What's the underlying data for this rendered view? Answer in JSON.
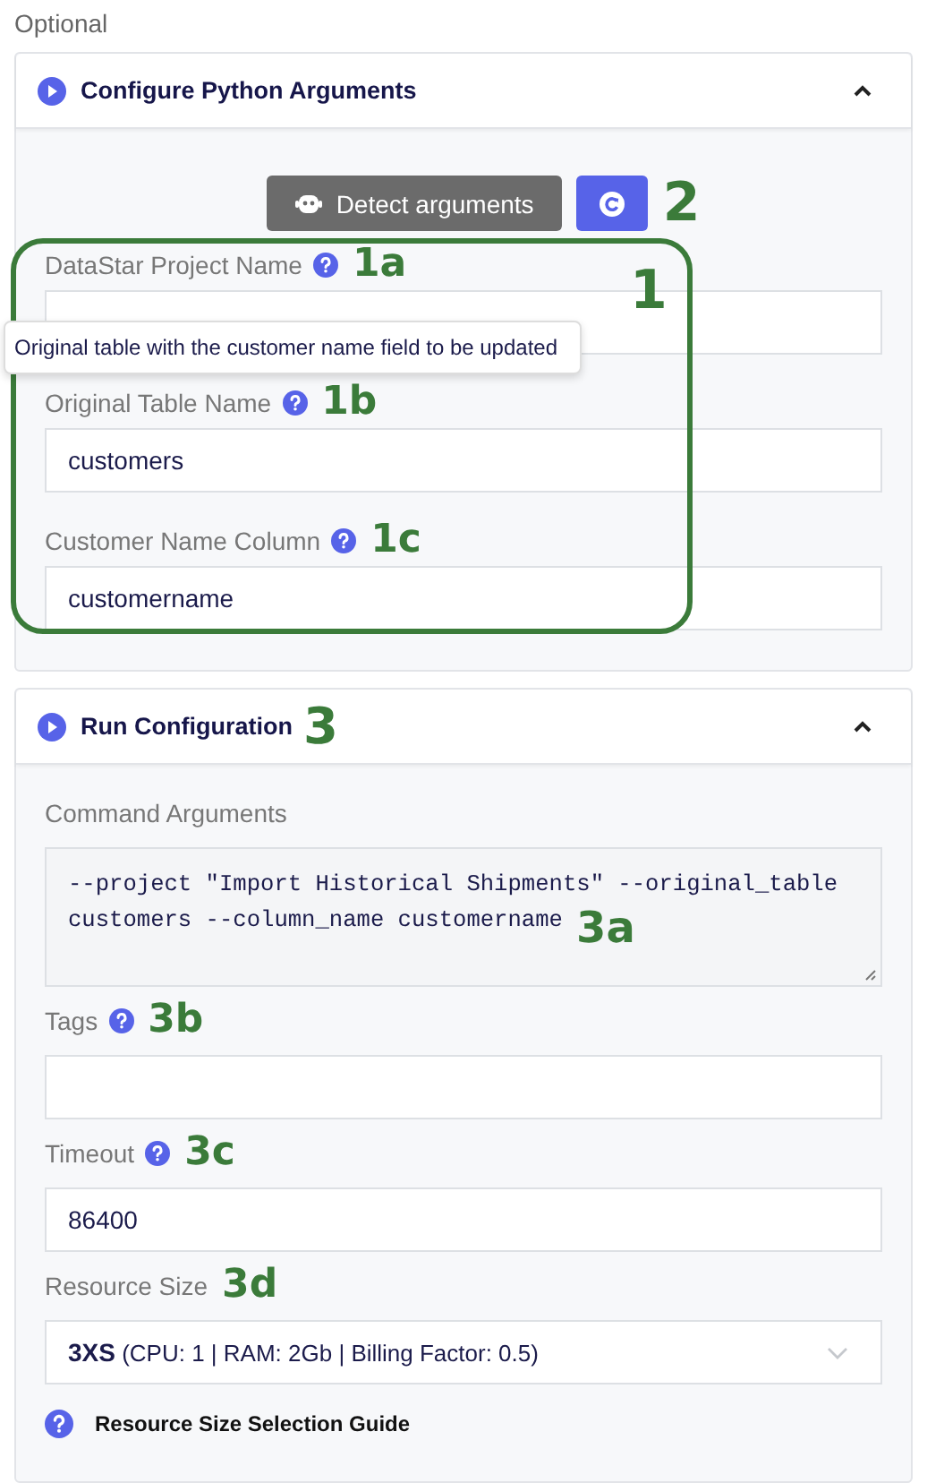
{
  "section_label": "Optional",
  "panels": [
    {
      "title": "Configure Python Arguments",
      "expanded": true,
      "actions": {
        "detect_button": "Detect arguments",
        "marker": "2"
      },
      "group": {
        "marker": "1",
        "highlighted": true
      },
      "tooltip": "Original table with the customer name field to be updated",
      "fields": [
        {
          "kind": "text",
          "label": "DataStar Project Name",
          "help": true,
          "marker": "1a"
        },
        {
          "kind": "text",
          "label": "Original Table Name",
          "help": true,
          "marker": "1b",
          "value": "customers"
        },
        {
          "kind": "text",
          "label": "Customer Name Column",
          "help": true,
          "marker": "1c",
          "value": "customername"
        }
      ]
    },
    {
      "title": "Run Configuration",
      "expanded": true,
      "marker": "3",
      "fields": [
        {
          "kind": "textarea",
          "label": "Command Arguments",
          "help": false,
          "marker": "3a",
          "value": "--project \"Import Historical Shipments\" --original_table customers --column_name customername"
        },
        {
          "kind": "text",
          "label": "Tags",
          "help": true,
          "marker": "3b"
        },
        {
          "kind": "text",
          "label": "Timeout",
          "help": true,
          "marker": "3c",
          "value": "86400"
        },
        {
          "kind": "select",
          "label": "Resource Size",
          "help": false,
          "marker": "3d",
          "value": "**3XS** (CPU: 1 | RAM: 2Gb | Billing Factor: 0.5)"
        }
      ],
      "guide_link": "Resource Size Selection Guide"
    }
  ]
}
